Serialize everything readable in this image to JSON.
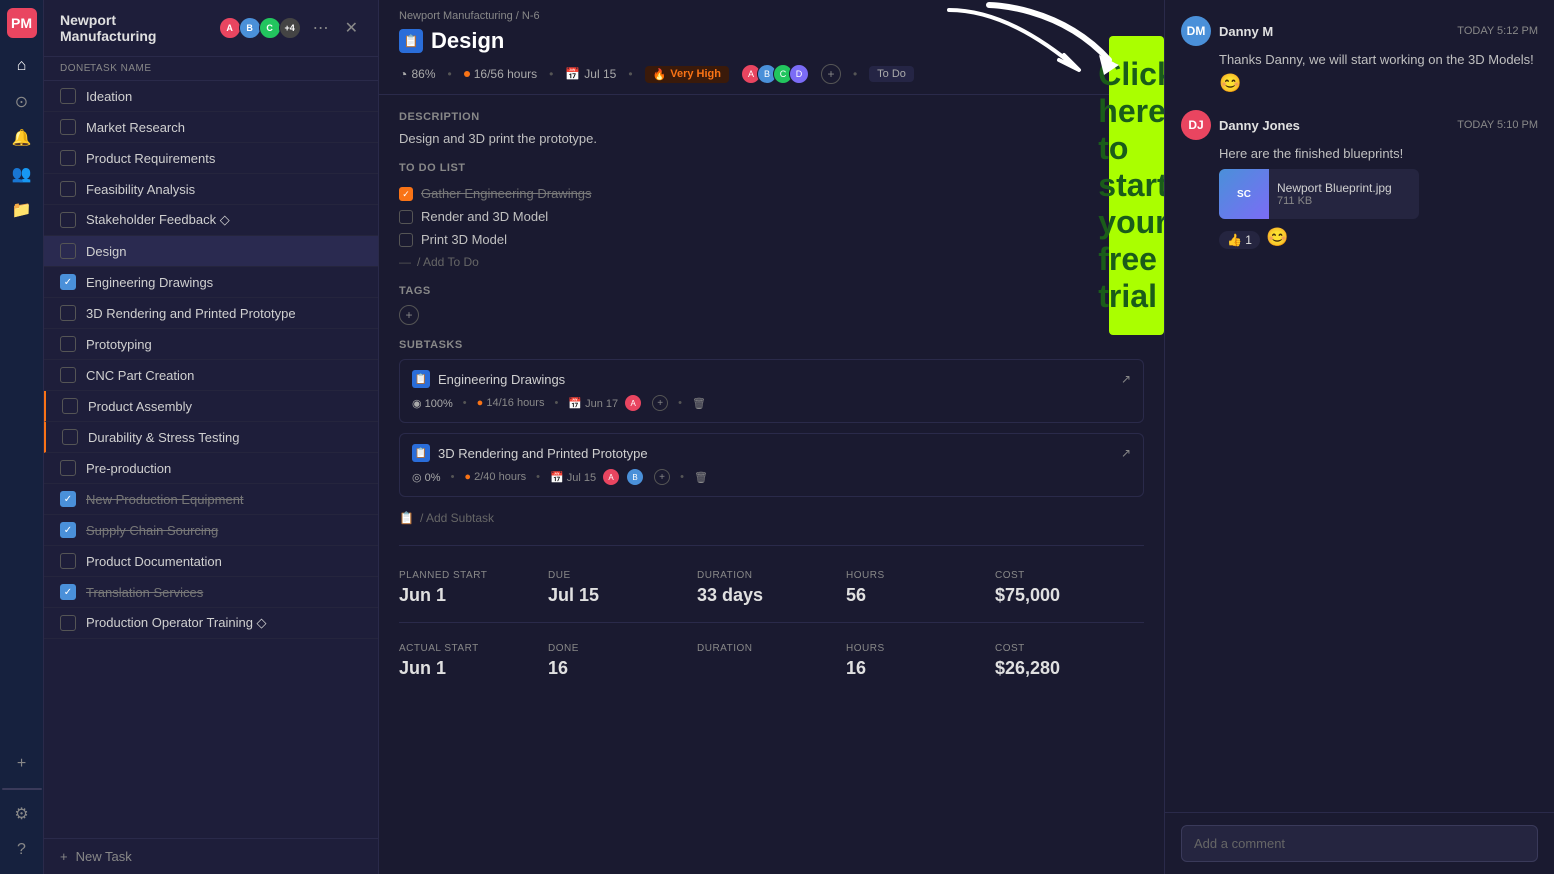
{
  "app": {
    "logo": "PM",
    "project_title": "Newport Manufacturing",
    "breadcrumb": {
      "project": "Newport Manufacturing",
      "separator": "/",
      "id": "N-6"
    }
  },
  "nav_icons": {
    "home": "⌂",
    "search": "⊙",
    "bell": "🔔",
    "users": "👥",
    "folder": "📁",
    "plus": "+",
    "settings": "⚙",
    "help": "?"
  },
  "task_panel": {
    "avatars": [
      {
        "initials": "A",
        "color": "#e94560"
      },
      {
        "initials": "B",
        "color": "#4a90d9"
      },
      {
        "initials": "C",
        "color": "#22c55e"
      },
      {
        "initials": "+4",
        "color": "#555"
      }
    ],
    "columns": {
      "done": "DONE",
      "name": "TASK NAME"
    },
    "tasks": [
      {
        "id": 1,
        "name": "Ideation",
        "done": false,
        "strikethrough": false,
        "active": false,
        "orange_bar": false
      },
      {
        "id": 2,
        "name": "Market Research",
        "done": false,
        "strikethrough": false,
        "active": false,
        "orange_bar": false
      },
      {
        "id": 3,
        "name": "Product Requirements",
        "done": false,
        "strikethrough": false,
        "active": false,
        "orange_bar": false
      },
      {
        "id": 4,
        "name": "Feasibility Analysis",
        "done": false,
        "strikethrough": false,
        "active": false,
        "orange_bar": false
      },
      {
        "id": 5,
        "name": "Stakeholder Feedback",
        "done": false,
        "strikethrough": false,
        "active": false,
        "orange_bar": false,
        "diamond": true
      },
      {
        "id": 6,
        "name": "Design",
        "done": false,
        "strikethrough": false,
        "active": true,
        "orange_bar": false
      },
      {
        "id": 7,
        "name": "Engineering Drawings",
        "done": true,
        "strikethrough": false,
        "active": false,
        "orange_bar": false
      },
      {
        "id": 8,
        "name": "3D Rendering and Printed Prototype",
        "done": false,
        "strikethrough": false,
        "active": false,
        "orange_bar": false
      },
      {
        "id": 9,
        "name": "Prototyping",
        "done": false,
        "strikethrough": false,
        "active": false,
        "orange_bar": false
      },
      {
        "id": 10,
        "name": "CNC Part Creation",
        "done": false,
        "strikethrough": false,
        "active": false,
        "orange_bar": false
      },
      {
        "id": 11,
        "name": "Product Assembly",
        "done": false,
        "strikethrough": false,
        "active": false,
        "orange_bar": true
      },
      {
        "id": 12,
        "name": "Durability & Stress Testing",
        "done": false,
        "strikethrough": false,
        "active": false,
        "orange_bar": true
      },
      {
        "id": 13,
        "name": "Pre-production",
        "done": false,
        "strikethrough": false,
        "active": false,
        "orange_bar": false
      },
      {
        "id": 14,
        "name": "New Production Equipment",
        "done": true,
        "strikethrough": true,
        "active": false,
        "orange_bar": false
      },
      {
        "id": 15,
        "name": "Supply Chain Sourcing",
        "done": true,
        "strikethrough": true,
        "active": false,
        "orange_bar": false
      },
      {
        "id": 16,
        "name": "Product Documentation",
        "done": false,
        "strikethrough": false,
        "active": false,
        "orange_bar": false
      },
      {
        "id": 17,
        "name": "Translation Services",
        "done": true,
        "strikethrough": true,
        "active": false,
        "orange_bar": false
      },
      {
        "id": 18,
        "name": "Production Operator Training",
        "done": false,
        "strikethrough": false,
        "active": false,
        "orange_bar": false,
        "diamond": true
      }
    ],
    "new_task_label": "New Task"
  },
  "main": {
    "task_title": "Design",
    "task_icon": "📋",
    "progress": "86%",
    "hours_done": "16",
    "hours_total": "56",
    "due_date": "Jul 15",
    "priority": "Very High",
    "priority_icon": "🔥",
    "status": "To Do",
    "description_label": "DESCRIPTION",
    "description": "Design and 3D print the prototype.",
    "todo_label": "TO DO LIST",
    "todos": [
      {
        "text": "Gather Engineering Drawings",
        "done": true
      },
      {
        "text": "Render and 3D Model",
        "done": false
      },
      {
        "text": "Print 3D Model",
        "done": false
      }
    ],
    "add_todo_placeholder": "/ Add To Do",
    "tags_label": "TAGS",
    "subtasks_label": "SUBTASKS",
    "subtasks": [
      {
        "id": 1,
        "title": "Engineering Drawings",
        "progress": "100%",
        "hours_done": "14",
        "hours_total": "16",
        "due": "Jun 17"
      },
      {
        "id": 2,
        "title": "3D Rendering and Printed Prototype",
        "progress": "0%",
        "hours_done": "2",
        "hours_total": "40",
        "due": "Jul 15"
      }
    ],
    "add_subtask_placeholder": "/ Add Subtask",
    "planned_start_label": "PLANNED START",
    "planned_start": "Jun 1",
    "due_label": "DUE",
    "due": "Jul 15",
    "duration_label": "DURATION",
    "duration": "33 days",
    "hours_label": "HOURS",
    "hours": "56",
    "cost_label": "COST",
    "cost": "$75,000",
    "actual_start_label": "ACTUAL START",
    "actual_start": "Jun 1",
    "done_label": "DONE",
    "done_value": "16",
    "actual_duration_label": "DURATION",
    "actual_duration": "",
    "actual_hours_label": "HOURS",
    "actual_hours": "16",
    "actual_cost_label": "COST",
    "actual_cost": "$26,280"
  },
  "cta": {
    "text": "Click here to start your free trial"
  },
  "comments": [
    {
      "id": 1,
      "avatar": "DM",
      "avatar_color": "#4a90d9",
      "name": "Danny M",
      "time": "TODAY 5:12 PM",
      "text": "Thanks Danny, we will start working on the 3D Models!"
    },
    {
      "id": 2,
      "avatar": "DJ",
      "avatar_color": "#e94560",
      "name": "Danny Jones",
      "time": "TODAY 5:10 PM",
      "text": "Here are the finished blueprints!",
      "attachment": {
        "name": "Newport Blueprint.jpg",
        "size": "711 KB",
        "thumb_text": "SC"
      }
    }
  ],
  "comment_input_placeholder": "Add a comment"
}
